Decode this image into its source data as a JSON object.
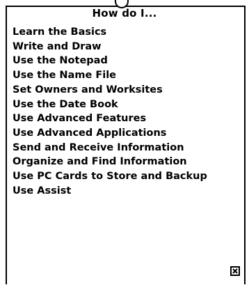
{
  "panel": {
    "title": "How do I...",
    "topics": [
      "Learn the Basics",
      "Write and Draw",
      "Use the Notepad",
      "Use the Name File",
      "Set Owners and Worksites",
      "Use the Date Book",
      "Use Advanced Features",
      "Use Advanced Applications",
      "Send and Receive Information",
      "Organize and Find Information",
      "Use PC Cards to Store and Backup",
      "Use Assist"
    ],
    "close_icon": "close-box-icon"
  },
  "colors": {
    "background": "#ffffff",
    "foreground": "#000000"
  }
}
